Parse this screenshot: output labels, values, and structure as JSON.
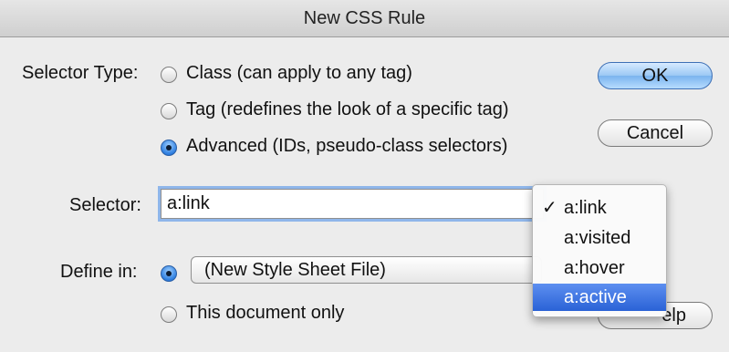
{
  "window": {
    "title": "New CSS Rule"
  },
  "selector_type": {
    "label": "Selector Type:",
    "options": [
      {
        "label": "Class (can apply to any tag)",
        "checked": false
      },
      {
        "label": "Tag (redefines the look of a specific tag)",
        "checked": false
      },
      {
        "label": "Advanced (IDs, pseudo-class selectors)",
        "checked": true
      }
    ]
  },
  "buttons": {
    "ok": "OK",
    "cancel": "Cancel",
    "help_visible": "elp"
  },
  "selector": {
    "label": "Selector:",
    "value": "a:link",
    "dropdown": {
      "items": [
        "a:link",
        "a:visited",
        "a:hover",
        "a:active"
      ],
      "checked_item": "a:link",
      "highlighted_item": "a:active",
      "check_mark": "✓"
    }
  },
  "define_in": {
    "label": "Define in:",
    "file_option_checked": true,
    "file_select_value": "(New Style Sheet File)",
    "document_only_label": "This document only",
    "document_only_checked": false
  },
  "colors": {
    "accent": "#2a62d6",
    "focus_ring": "#8fb6ea"
  }
}
